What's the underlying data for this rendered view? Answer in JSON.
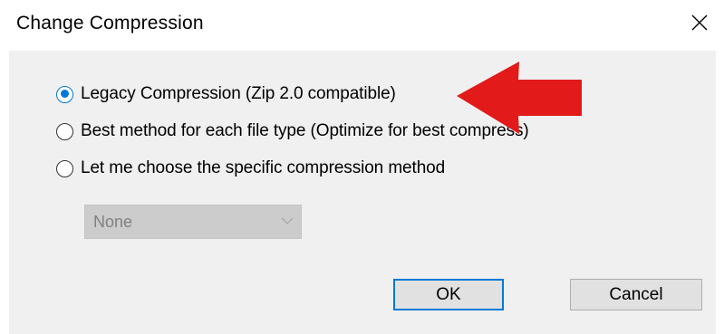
{
  "window": {
    "title": "Change Compression",
    "close_icon": "close-icon"
  },
  "options": [
    {
      "label": "Legacy Compression (Zip 2.0 compatible)",
      "checked": true
    },
    {
      "label": "Best method for each file type (Optimize for best compress)",
      "checked": false
    },
    {
      "label": "Let me choose the specific compression method",
      "checked": false
    }
  ],
  "method_select": {
    "value": "None",
    "enabled": false
  },
  "buttons": {
    "ok_label": "OK",
    "cancel_label": "Cancel"
  },
  "annotation": {
    "icon": "red-arrow-icon",
    "color": "#e21a1a"
  },
  "colors": {
    "accent": "#0078d7",
    "client_bg": "#f0f0f0",
    "button_bg": "#e1e1e1",
    "disabled_bg": "#cccccc"
  }
}
